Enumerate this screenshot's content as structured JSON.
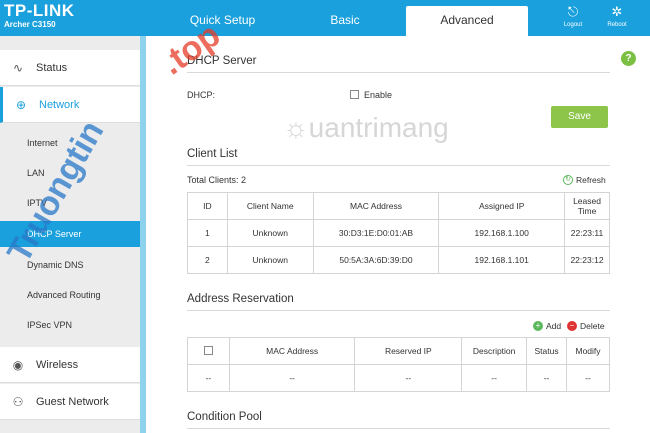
{
  "header": {
    "logo": "TP-LINK",
    "model": "Archer C3150",
    "tabs": [
      "Quick Setup",
      "Basic",
      "Advanced"
    ],
    "logout_label": "Logout",
    "reboot_label": "Reboot"
  },
  "sidebar": {
    "status": "Status",
    "network": "Network",
    "sub_items": [
      "Internet",
      "LAN",
      "IPTV",
      "DHCP Server",
      "Dynamic DNS",
      "Advanced Routing",
      "IPSec VPN"
    ],
    "wireless": "Wireless",
    "guest": "Guest Network"
  },
  "dhcp": {
    "title": "DHCP Server",
    "label": "DHCP:",
    "enable": "Enable",
    "save": "Save"
  },
  "client_list": {
    "title": "Client List",
    "total": "Total Clients: 2",
    "refresh": "Refresh",
    "headers": [
      "ID",
      "Client Name",
      "MAC Address",
      "Assigned IP",
      "Leased Time"
    ],
    "rows": [
      [
        "1",
        "Unknown",
        "30:D3:1E:D0:01:AB",
        "192.168.1.100",
        "22:23:11"
      ],
      [
        "2",
        "Unknown",
        "50:5A:3A:6D:39:D0",
        "192.168.1.101",
        "22:23:12"
      ]
    ]
  },
  "address_reservation": {
    "title": "Address Reservation",
    "add": "Add",
    "delete": "Delete",
    "headers": [
      "MAC Address",
      "Reserved IP",
      "Description",
      "Status",
      "Modify"
    ],
    "empty_row": [
      "--",
      "--",
      "--",
      "--",
      "--",
      "--"
    ]
  },
  "condition_pool": {
    "title": "Condition Pool"
  },
  "watermarks": {
    "left": "Truongtin",
    "tld": ".top",
    "center": "uantrimang"
  },
  "colors": {
    "brand": "#1aa0dc",
    "save": "#8dc54b",
    "add": "#5cb85c",
    "delete": "#e03434"
  }
}
